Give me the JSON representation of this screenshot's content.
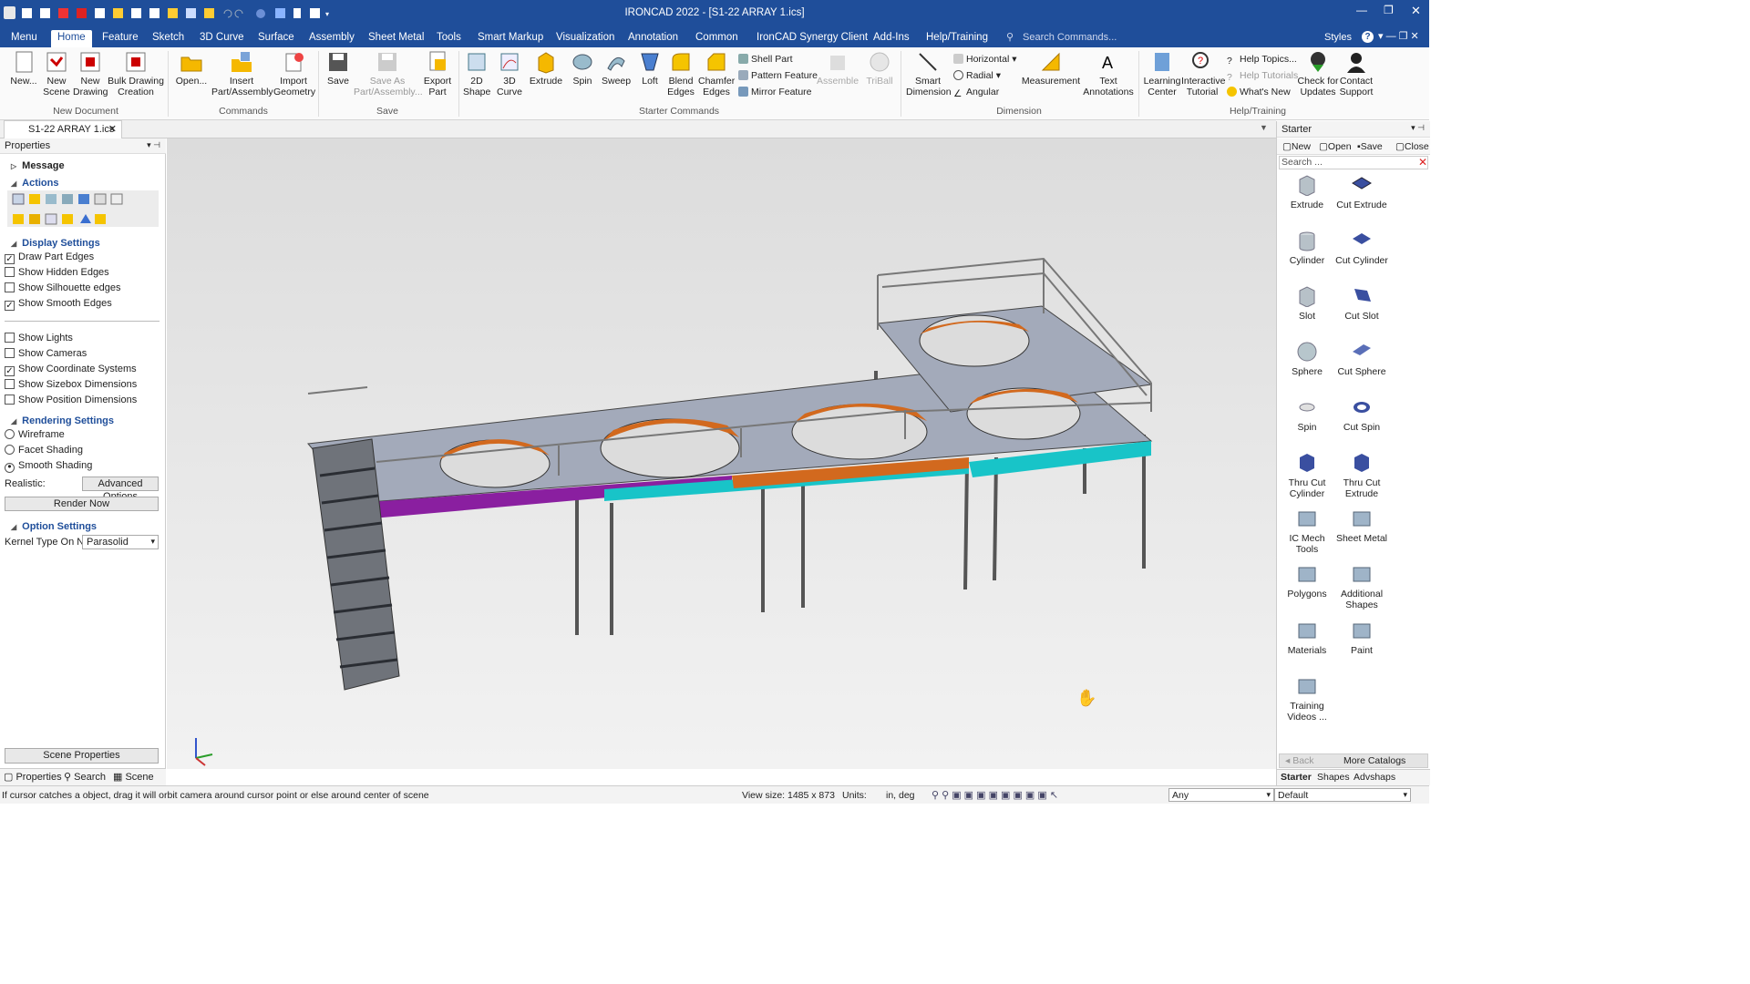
{
  "window": {
    "title": "IRONCAD 2022 - [S1-22 ARRAY 1.ics]",
    "styles_label": "Styles"
  },
  "menu": {
    "items": [
      "Menu",
      "Home",
      "Feature",
      "Sketch",
      "3D Curve",
      "Surface",
      "Assembly",
      "Sheet Metal",
      "Tools",
      "Smart Markup",
      "Visualization",
      "Annotation",
      "Common",
      "IronCAD Synergy Client",
      "Add-Ins",
      "Help/Training"
    ],
    "active": "Home",
    "search_placeholder": "Search Commands..."
  },
  "ribbon": {
    "new_document": {
      "group": "New Document",
      "buttons": [
        "New...",
        "New Scene",
        "New Drawing",
        "Bulk Drawing Creation"
      ]
    },
    "commands": {
      "group": "Commands",
      "buttons": [
        "Open...",
        "Insert Part/Assembly",
        "Import Geometry"
      ]
    },
    "save": {
      "group": "Save",
      "buttons": [
        "Save",
        "Save As Part/Assembly...",
        "Export Part"
      ]
    },
    "starter": {
      "group": "Starter Commands",
      "buttons": [
        "2D Shape",
        "3D Curve",
        "Extrude",
        "Spin",
        "Sweep",
        "Loft",
        "Blend Edges",
        "Chamfer Edges"
      ],
      "small": [
        "Shell Part",
        "Pattern Feature",
        "Mirror Feature"
      ],
      "disabled": [
        "Assemble",
        "TriBall"
      ]
    },
    "dimension": {
      "group": "Dimension",
      "buttons": [
        "Smart Dimension",
        "Measurement"
      ],
      "small": [
        "Horizontal",
        "Radial",
        "Angular"
      ]
    },
    "annot": {
      "buttons": [
        "Text Annotations"
      ]
    },
    "help": {
      "group": "Help/Training",
      "buttons": [
        "Learning Center",
        "Interactive Tutorial",
        "Check for Updates",
        "Contact Support"
      ],
      "small": [
        "Help Topics...",
        "Help Tutorials",
        "What's New"
      ]
    }
  },
  "doc_tab": "S1-22 ARRAY 1.ics",
  "properties": {
    "title": "Properties",
    "message": "Message",
    "actions": "Actions",
    "display_settings": "Display Settings",
    "display": [
      {
        "label": "Draw Part Edges",
        "checked": true
      },
      {
        "label": "Show Hidden Edges",
        "checked": false
      },
      {
        "label": "Show Silhouette edges",
        "checked": false
      },
      {
        "label": "Show Smooth Edges",
        "checked": true
      }
    ],
    "show": [
      {
        "label": "Show Lights",
        "checked": false
      },
      {
        "label": "Show Cameras",
        "checked": false
      },
      {
        "label": "Show Coordinate Systems",
        "checked": true
      },
      {
        "label": "Show Sizebox Dimensions",
        "checked": false
      },
      {
        "label": "Show Position Dimensions",
        "checked": false
      }
    ],
    "rendering_settings": "Rendering Settings",
    "rendering": [
      {
        "label": "Wireframe",
        "selected": false
      },
      {
        "label": "Facet Shading",
        "selected": false
      },
      {
        "label": "Smooth Shading",
        "selected": true
      }
    ],
    "realistic_label": "Realistic:",
    "advanced_options": "Advanced Options",
    "render_now": "Render Now",
    "option_settings": "Option Settings",
    "kernel_label": "Kernel Type On N...",
    "kernel_value": "Parasolid",
    "scene_properties": "Scene Properties",
    "bottom_tabs": [
      "Properties",
      "Search",
      "Scene"
    ]
  },
  "starter_panel": {
    "title": "Starter",
    "toolbar": [
      "New",
      "Open",
      "Save",
      "Close"
    ],
    "search_placeholder": "Search ...",
    "items": [
      "Extrude",
      "Cut Extrude",
      "Cylinder",
      "Cut Cylinder",
      "Slot",
      "Cut Slot",
      "Sphere",
      "Cut Sphere",
      "Spin",
      "Cut Spin",
      "Thru Cut Cylinder",
      "Thru Cut Extrude",
      "IC Mech Tools",
      "Sheet Metal",
      "Polygons",
      "Additional Shapes",
      "Materials",
      "Paint",
      "Training Videos ..."
    ],
    "back": "Back",
    "more_catalogs": "More Catalogs",
    "tabs": [
      "Starter",
      "Shapes",
      "Advshaps"
    ]
  },
  "status": {
    "message": "If cursor catches a object, drag it will orbit camera around cursor point or else around center of scene",
    "view_size": "View size: 1485 x 873",
    "units_label": "Units:",
    "units_value": "in, deg",
    "filter": "Any",
    "style": "Default"
  },
  "colors": {
    "titlebar": "#1f4e9a",
    "steel": "#9aa3b5",
    "orange": "#d2691e",
    "cyan": "#18c4c8",
    "purple": "#8a1fa0",
    "green": "#2f8f2f"
  }
}
